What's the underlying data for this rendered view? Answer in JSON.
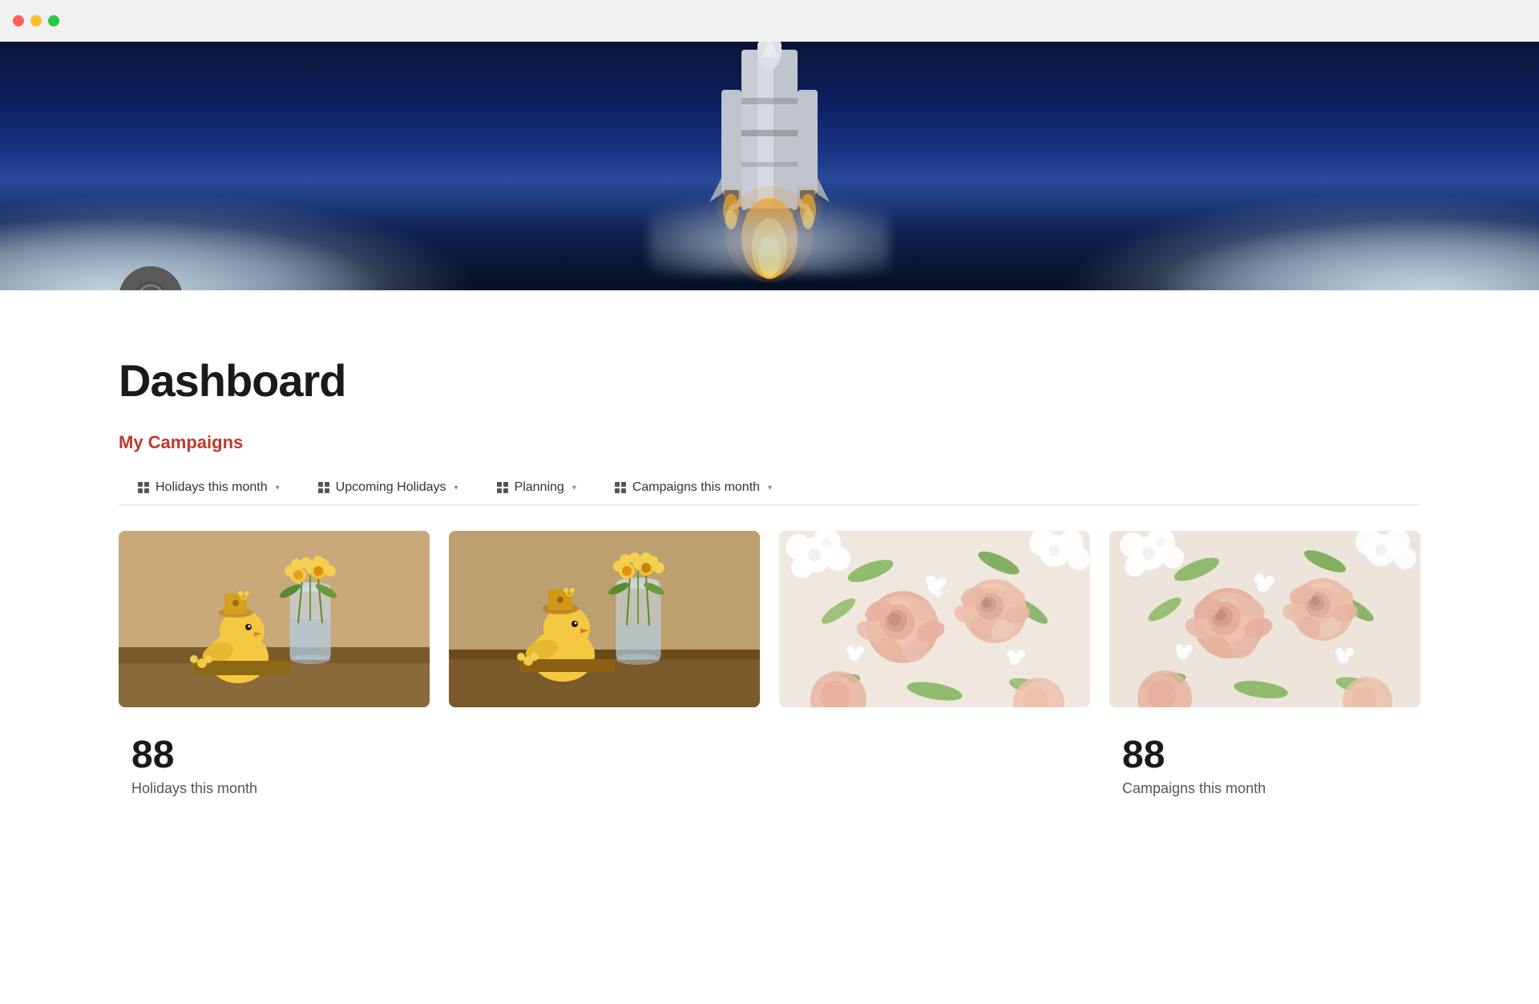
{
  "titlebar": {
    "traffic_lights": [
      "red",
      "yellow",
      "green"
    ]
  },
  "hero": {
    "alt": "Rocket launch"
  },
  "page_icon": {
    "symbol": "⊖"
  },
  "content": {
    "page_title": "Dashboard",
    "section_title": "My Campaigns",
    "tabs": [
      {
        "id": "holidays-month",
        "label": "Holidays this month",
        "icon": "grid"
      },
      {
        "id": "upcoming-holidays",
        "label": "Upcoming Holidays",
        "icon": "grid"
      },
      {
        "id": "planning",
        "label": "Planning",
        "icon": "grid"
      },
      {
        "id": "campaigns-month",
        "label": "Campaigns this month",
        "icon": "grid"
      }
    ],
    "cards": [
      {
        "id": "card-1",
        "type": "chick",
        "alt": "Yellow chick with flowers"
      },
      {
        "id": "card-2",
        "type": "chick",
        "alt": "Yellow chick with flowers 2"
      },
      {
        "id": "card-3",
        "type": "roses",
        "alt": "Pink roses"
      },
      {
        "id": "card-4",
        "type": "roses",
        "alt": "Pink roses 2"
      }
    ],
    "stats": [
      {
        "id": "stat-holidays",
        "number": "88",
        "label": "Holidays this month"
      },
      {
        "id": "stat-upcoming",
        "number": "",
        "label": ""
      },
      {
        "id": "stat-planning",
        "number": "",
        "label": ""
      },
      {
        "id": "stat-campaigns",
        "number": "88",
        "label": "Campaigns this month"
      }
    ]
  }
}
